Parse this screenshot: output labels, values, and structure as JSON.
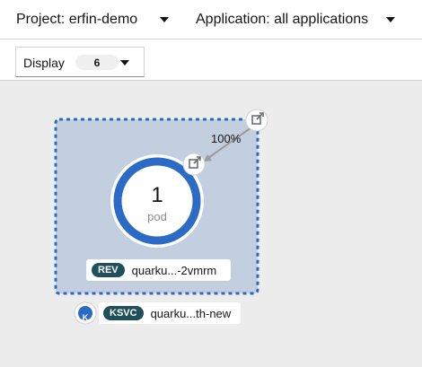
{
  "header": {
    "project_label": "Project: erfin-demo",
    "application_label": "Application: all applications"
  },
  "toolbar": {
    "display_label": "Display",
    "display_count": "6"
  },
  "topology": {
    "traffic_percent": "100%",
    "pod_count": "1",
    "pod_label": "pod",
    "revision": {
      "badge": "REV",
      "name": "quarku...-2vmrm"
    },
    "service": {
      "badge": "KSVC",
      "name": "quarku...th-new",
      "icon_letter": "K"
    }
  }
}
